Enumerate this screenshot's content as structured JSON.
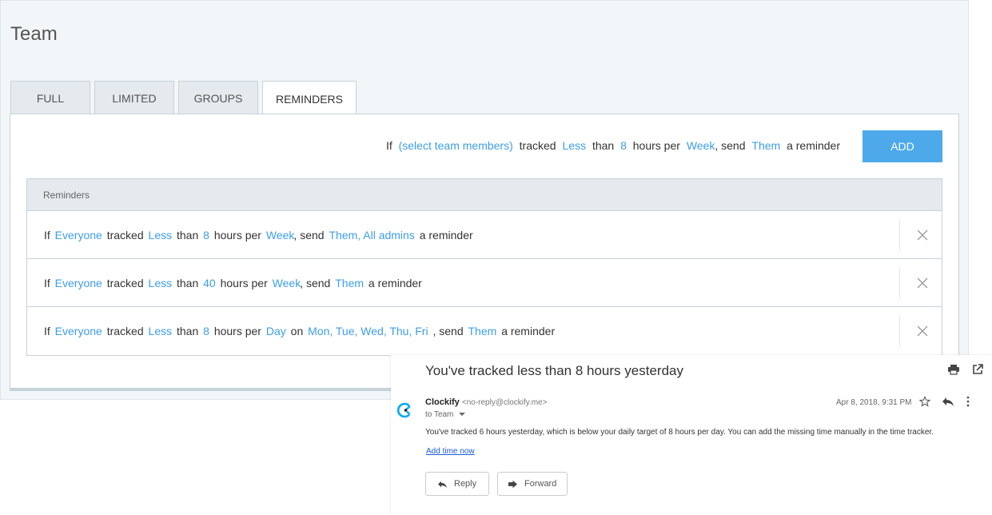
{
  "page": {
    "title": "Team"
  },
  "tabs": [
    {
      "label": "FULL",
      "active": false
    },
    {
      "label": "LIMITED",
      "active": false
    },
    {
      "label": "GROUPS",
      "active": false
    },
    {
      "label": "REMINDERS",
      "active": true
    }
  ],
  "new_rule": {
    "if": "If",
    "members": "(select team members)",
    "tracked": "tracked",
    "comparator": "Less",
    "than": "than",
    "hours": "8",
    "hours_per": "hours per",
    "period": "Week",
    "send": ", send",
    "recipients": "Them",
    "suffix": "a reminder",
    "add_label": "ADD"
  },
  "reminders": {
    "header": "Reminders",
    "rows": [
      {
        "if": "If",
        "members": "Everyone",
        "tracked": "tracked",
        "comparator": "Less",
        "than": "than",
        "hours": "8",
        "hours_per": "hours per",
        "period": "Week",
        "send": ", send",
        "recipients": "Them, All admins",
        "suffix": "a reminder"
      },
      {
        "if": "If",
        "members": "Everyone",
        "tracked": "tracked",
        "comparator": "Less",
        "than": "than",
        "hours": "40",
        "hours_per": "hours per",
        "period": "Week",
        "send": ", send",
        "recipients": "Them",
        "suffix": "a reminder"
      },
      {
        "if": "If",
        "members": "Everyone",
        "tracked": "tracked",
        "comparator": "Less",
        "than": "than",
        "hours": "8",
        "hours_per": "hours per",
        "period": "Day",
        "on": "on",
        "days": "Mon, Tue, Wed, Thu, Fri",
        "send": ", send",
        "recipients": "Them",
        "suffix": "a reminder"
      }
    ]
  },
  "email": {
    "subject": "You've tracked less than 8 hours yesterday",
    "sender_name": "Clockify",
    "sender_email": "<no-reply@clockify.me>",
    "to": "to Team",
    "date": "Apr 8, 2018, 9:31 PM",
    "body": "You've tracked 6 hours yesterday, which is below your daily target of 8 hours per day. You can add the missing time manually in the time tracker.",
    "link": "Add time now",
    "reply_label": "Reply",
    "forward_label": "Forward"
  },
  "colors": {
    "accent": "#3d9ee8",
    "add_button": "#4da9ea",
    "link": "#1a5bd5"
  }
}
